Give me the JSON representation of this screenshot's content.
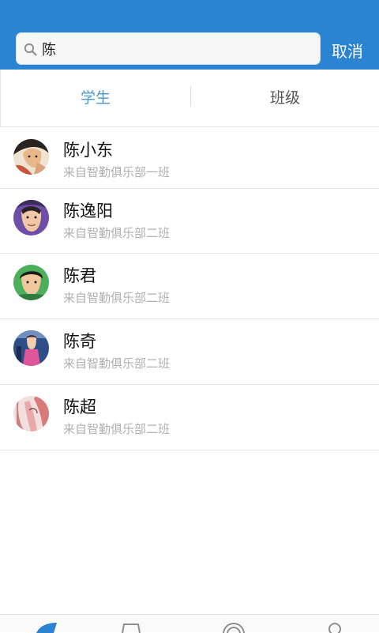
{
  "search": {
    "value": "陈",
    "cancel_label": "取消"
  },
  "tabs": [
    {
      "label": "学生"
    },
    {
      "label": "班级"
    }
  ],
  "results": [
    {
      "name": "陈小东",
      "subtitle": "来自智勤俱乐部一班"
    },
    {
      "name": "陈逸阳",
      "subtitle": "来自智勤俱乐部二班"
    },
    {
      "name": "陈君",
      "subtitle": "来自智勤俱乐部二班"
    },
    {
      "name": "陈奇",
      "subtitle": "来自智勤俱乐部二班"
    },
    {
      "name": "陈超",
      "subtitle": "来自智勤俱乐部二班"
    }
  ],
  "colors": {
    "header": "#2a84d2",
    "tab_active": "#4a96cf"
  }
}
